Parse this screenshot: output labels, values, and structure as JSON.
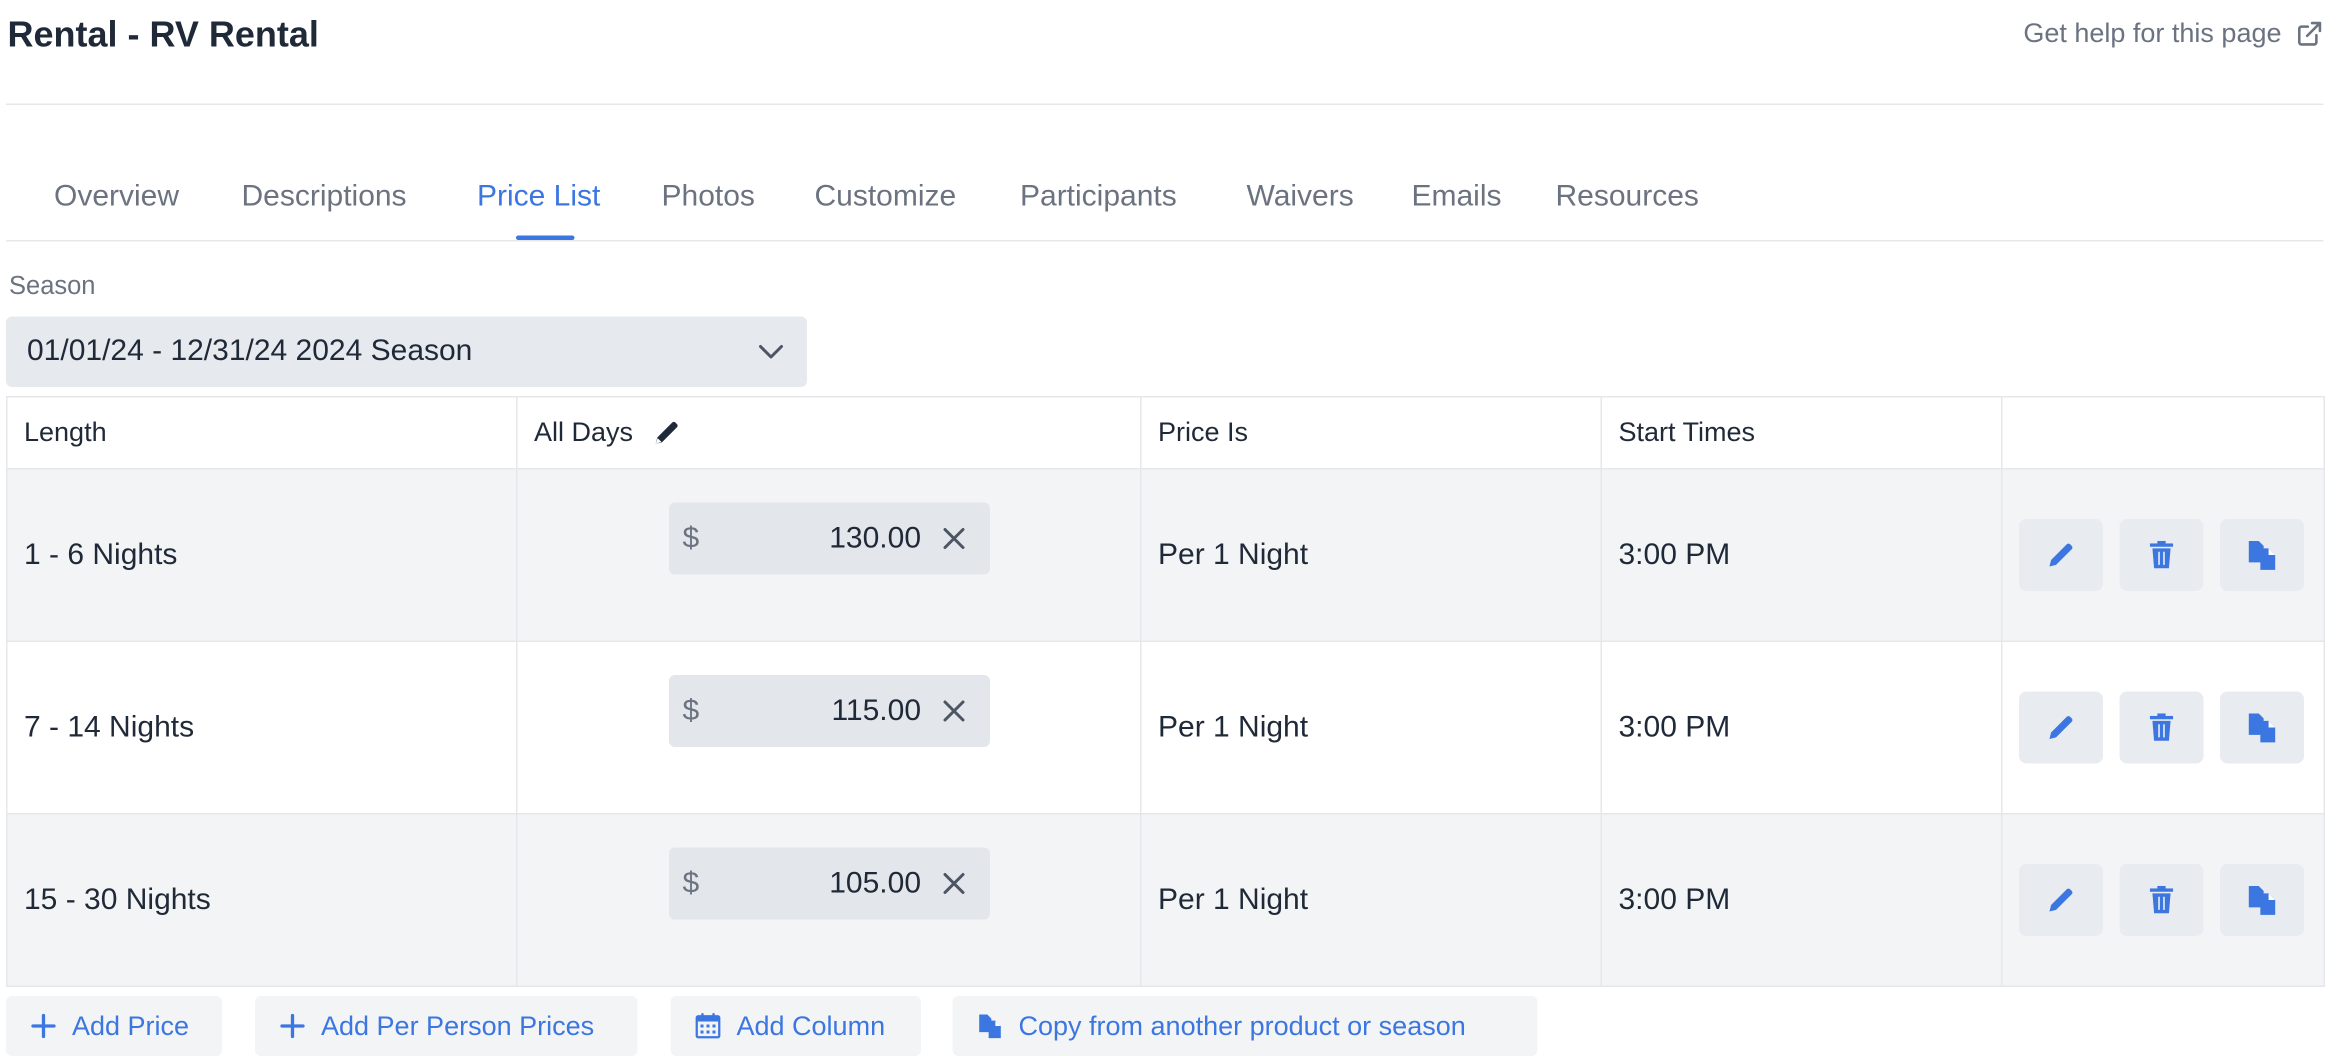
{
  "header": {
    "title": "Rental - RV Rental",
    "help_label": "Get help for this page"
  },
  "tabs": [
    {
      "label": "Overview"
    },
    {
      "label": "Descriptions"
    },
    {
      "label": "Price List"
    },
    {
      "label": "Photos"
    },
    {
      "label": "Customize"
    },
    {
      "label": "Participants"
    },
    {
      "label": "Waivers"
    },
    {
      "label": "Emails"
    },
    {
      "label": "Resources"
    }
  ],
  "active_tab": "Price List",
  "season": {
    "label": "Season",
    "selected": "01/01/24 - 12/31/24 2024 Season"
  },
  "table": {
    "headers": {
      "length": "Length",
      "all_days": "All Days",
      "price_is": "Price Is",
      "start_times": "Start Times",
      "actions": ""
    },
    "rows": [
      {
        "length": "1 - 6 Nights",
        "currency": "$",
        "amount": "130.00",
        "price_is": "Per 1 Night",
        "start_time": "3:00 PM"
      },
      {
        "length": "7 - 14 Nights",
        "currency": "$",
        "amount": "115.00",
        "price_is": "Per 1 Night",
        "start_time": "3:00 PM"
      },
      {
        "length": "15 - 30 Nights",
        "currency": "$",
        "amount": "105.00",
        "price_is": "Per 1 Night",
        "start_time": "3:00 PM"
      }
    ]
  },
  "buttons": {
    "add_price": "Add Price",
    "add_per_person": "Add Per Person Prices",
    "add_column": "Add Column",
    "copy_from": "Copy from another product or season"
  },
  "colors": {
    "accent": "#3b76e1",
    "muted_text": "#6b7280",
    "row_alt": "#f3f4f6"
  },
  "icons": {
    "help": "external-link-icon",
    "season": "chevron-down-icon",
    "header_edit": "pencil-icon",
    "clear": "close-icon",
    "row_edit": "pencil-icon",
    "row_delete": "trash-icon",
    "row_copy": "copy-icon",
    "add": "plus-icon",
    "calendar": "calendar-icon"
  }
}
